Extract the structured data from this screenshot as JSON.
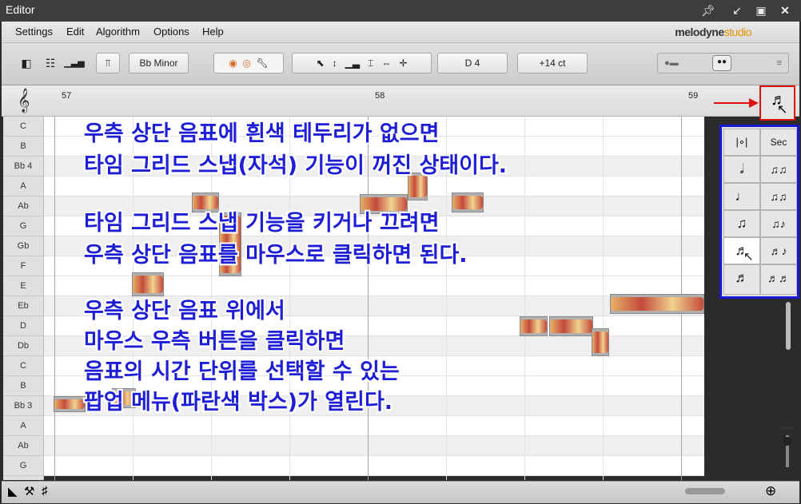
{
  "window": {
    "title": "Editor"
  },
  "menu": {
    "items": [
      "Settings",
      "Edit",
      "Algorithm",
      "Options",
      "Help"
    ],
    "logo_main": "melodyne",
    "logo_sub": "studio"
  },
  "toolbar": {
    "key_label": "Bb Minor",
    "pitch_readout": "D 4",
    "cents_readout": "+14 ct"
  },
  "ruler": {
    "bars": [
      "57",
      "58",
      "59"
    ]
  },
  "pitches": [
    "C",
    "B",
    "Bb 4",
    "A",
    "Ab",
    "G",
    "Gb",
    "F",
    "E",
    "Eb",
    "D",
    "Db",
    "C",
    "B",
    "Bb 3",
    "A",
    "Ab",
    "G"
  ],
  "annotation": {
    "line1": "우측 상단 음표에 흰색 테두리가 없으면",
    "line2": "타임 그리드 스냅(자석) 기능이 꺼진 상태이다.",
    "line3": "타임 그리드 스냅 기능을 키거나 끄려면",
    "line4": "우측 상단 음표를 마우스로 클릭하면 된다.",
    "line5": "우측 상단 음표 위에서",
    "line6": "마우스 우측 버튼을 클릭하면",
    "line7": "음표의 시간 단위를 선택할 수 있는",
    "line8": "팝업 메뉴(파란색 박스)가 열린다."
  },
  "popup": {
    "bar_label": "|∘|",
    "sec_label": "Sec"
  },
  "colors": {
    "annotation": "#1e1ed6",
    "highlight_red": "#e01010",
    "popup_border": "#1717d8",
    "accent": "#e49400"
  },
  "icons": [
    "treble-clef-icon",
    "note-value-icon",
    "pointer-tool-icon",
    "pitch-tool-icon",
    "formant-tool-icon",
    "amplitude-tool-icon",
    "time-tool-icon",
    "move-tool-icon",
    "red-arrow-icon"
  ]
}
